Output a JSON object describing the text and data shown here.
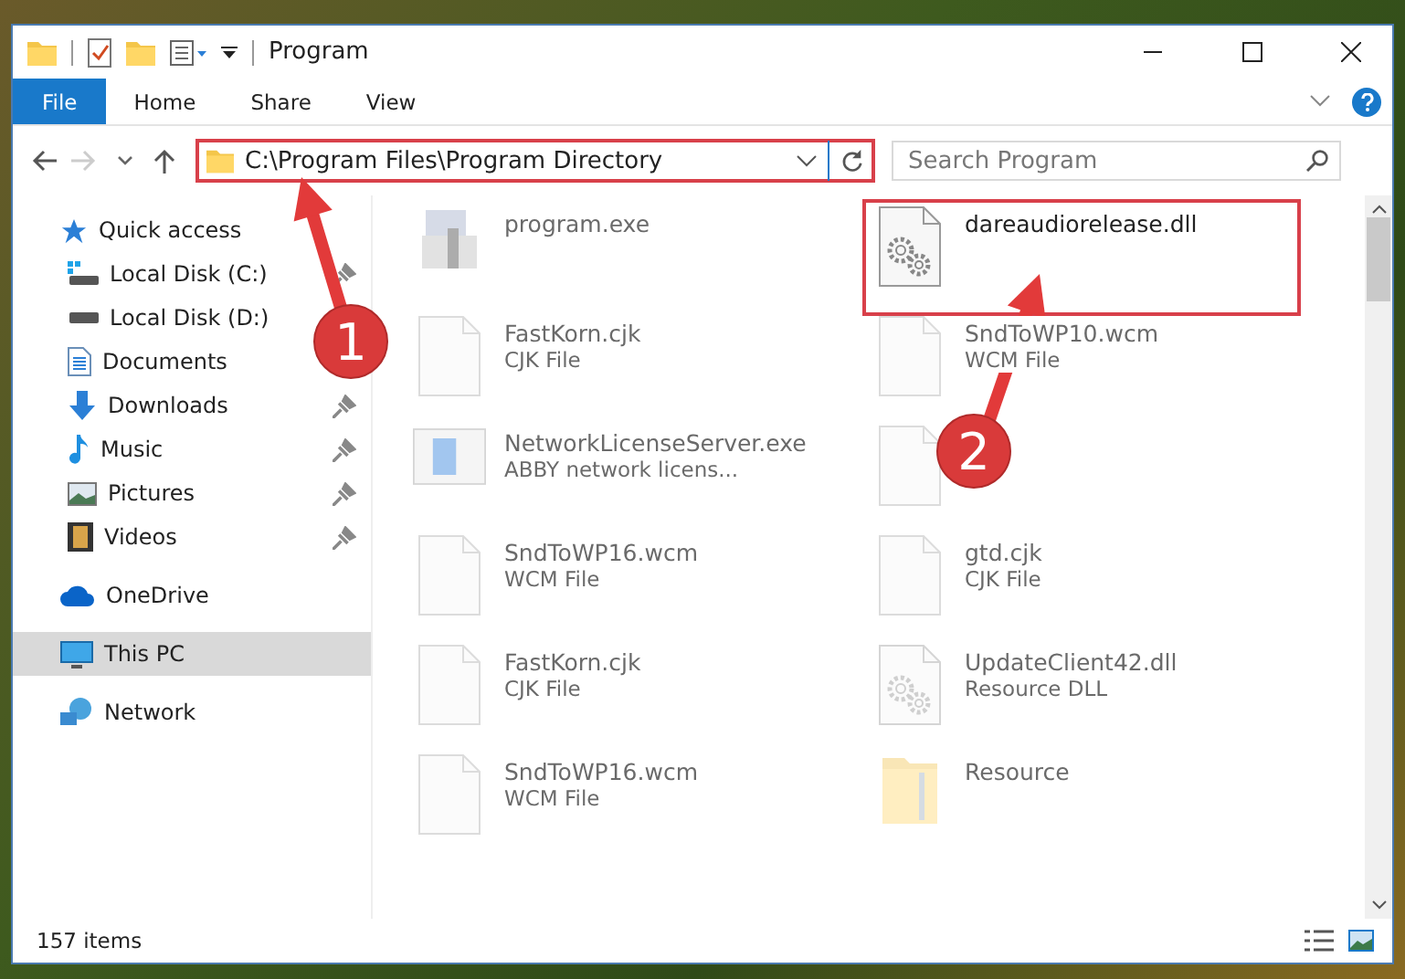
{
  "window": {
    "title": "Program"
  },
  "ribbon": {
    "tabs": [
      {
        "label": "File",
        "selected": true
      },
      {
        "label": "Home",
        "selected": false
      },
      {
        "label": "Share",
        "selected": false
      },
      {
        "label": "View",
        "selected": false
      }
    ]
  },
  "address": {
    "path": "C:\\Program Files\\Program Directory",
    "highlighted": true
  },
  "search": {
    "placeholder": "Search Program"
  },
  "sidebar": {
    "items": [
      {
        "label": "Quick access",
        "kind": "star",
        "selected": false,
        "children": [
          {
            "label": "Local Disk (C:)",
            "kind": "system-drive",
            "pinned": true,
            "selected": false
          },
          {
            "label": "Local Disk (D:)",
            "kind": "drive",
            "pinned": false,
            "selected": false
          },
          {
            "label": "Documents",
            "kind": "documents",
            "pinned": false,
            "selected": false
          },
          {
            "label": "Downloads",
            "kind": "downloads",
            "pinned": true,
            "selected": false
          },
          {
            "label": "Music",
            "kind": "music",
            "pinned": true,
            "selected": false
          },
          {
            "label": "Pictures",
            "kind": "pictures",
            "pinned": true,
            "selected": false
          },
          {
            "label": "Videos",
            "kind": "videos",
            "pinned": true,
            "selected": false
          }
        ]
      },
      {
        "label": "OneDrive",
        "kind": "cloud",
        "selected": false
      },
      {
        "label": "This PC",
        "kind": "computer",
        "selected": true
      },
      {
        "label": "Network",
        "kind": "network",
        "selected": false
      }
    ]
  },
  "files": [
    {
      "name": "program.exe",
      "kind": "exe",
      "faded": true,
      "highlighted": false
    },
    {
      "name": "dareaudiorelease.dll",
      "kind": "dll",
      "faded": false,
      "highlighted": true
    },
    {
      "name": "FastKorn.cjk",
      "type": "CJK File",
      "kind": "blank",
      "faded": true,
      "highlighted": false
    },
    {
      "name": "SndToWP10.wcm",
      "type": "WCM File",
      "kind": "blank",
      "faded": true,
      "highlighted": false
    },
    {
      "name": "NetworkLicenseServer.exe",
      "type": "ABBY network licens...",
      "kind": "app",
      "faded": true,
      "highlighted": false
    },
    {
      "kind": "blank",
      "faded": true,
      "highlighted": false
    },
    {
      "name": "SndToWP16.wcm",
      "type": "WCM File",
      "kind": "blank",
      "faded": true,
      "highlighted": false
    },
    {
      "name": "gtd.cjk",
      "type": "CJK File",
      "kind": "blank",
      "faded": true,
      "highlighted": false
    },
    {
      "name": "FastKorn.cjk",
      "type": "CJK File",
      "kind": "blank",
      "faded": true,
      "highlighted": false
    },
    {
      "name": "UpdateClient42.dll",
      "type": "Resource DLL",
      "kind": "dll",
      "faded": true,
      "highlighted": false
    },
    {
      "name": "SndToWP16.wcm",
      "type": "WCM File",
      "kind": "blank",
      "faded": true,
      "highlighted": false
    },
    {
      "name": "Resource",
      "kind": "folder",
      "faded": true,
      "highlighted": false
    }
  ],
  "status_bar": {
    "item_count": "157 items"
  },
  "callouts": [
    {
      "number": "1"
    },
    {
      "number": "2"
    }
  ]
}
